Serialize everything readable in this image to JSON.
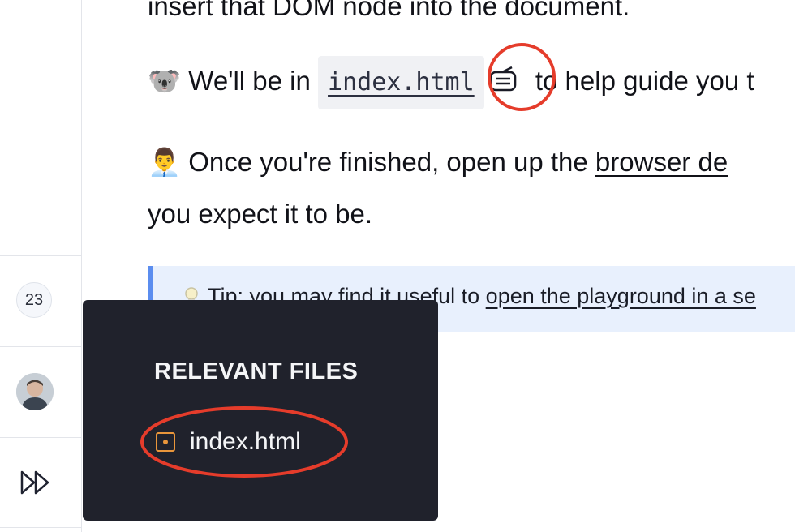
{
  "content": {
    "line_top": "insert that DOM node into the document.",
    "para1": {
      "emoji": "🐨",
      "before": "We'll be in",
      "code": "index.html",
      "after": "to help guide you t"
    },
    "para2": {
      "emoji": "👨‍💼",
      "before": "Once you're finished, open up the",
      "link": "browser de",
      "line2": "you expect it to be."
    },
    "tip": {
      "icon": "lightbulb-icon",
      "text": "Tip: you may find it useful to",
      "link": "open the playground in a se"
    }
  },
  "rail": {
    "count": "23",
    "forward_icon": "fast-forward-icon"
  },
  "popover": {
    "title": "RELEVANT FILES",
    "file": "index.html",
    "file_icon": "file-icon"
  },
  "colors": {
    "annotation": "#e53c2b",
    "tip_border": "#5b8def",
    "popover_bg": "#20222c",
    "file_icon": "#e9963b"
  }
}
